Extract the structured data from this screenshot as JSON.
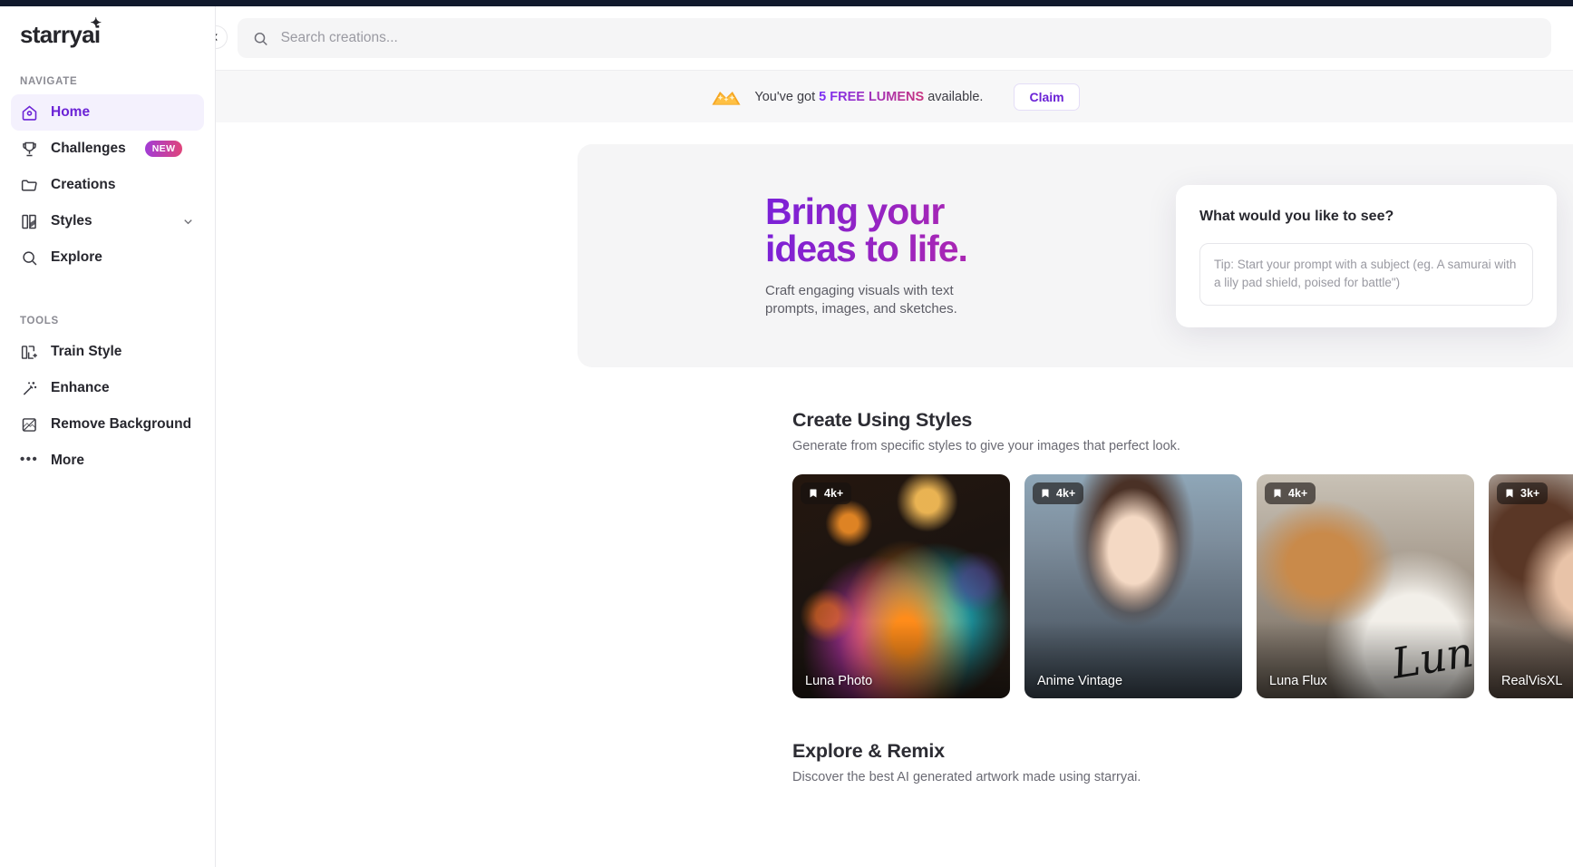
{
  "brand": {
    "name": "starryai"
  },
  "sidebar": {
    "groups": [
      {
        "label": "NAVIGATE",
        "items": [
          {
            "label": "Home",
            "icon": "home-icon",
            "active": true
          },
          {
            "label": "Challenges",
            "icon": "trophy-icon",
            "badge": "NEW"
          },
          {
            "label": "Creations",
            "icon": "folder-icon"
          },
          {
            "label": "Styles",
            "icon": "styles-icon",
            "chevron": "chevron-down-icon"
          },
          {
            "label": "Explore",
            "icon": "search-icon"
          }
        ]
      },
      {
        "label": "TOOLS",
        "items": [
          {
            "label": "Train Style",
            "icon": "train-style-icon"
          },
          {
            "label": "Enhance",
            "icon": "magic-wand-icon"
          },
          {
            "label": "Remove Background",
            "icon": "remove-background-icon"
          },
          {
            "label": "More",
            "icon": "ellipsis-icon"
          }
        ]
      }
    ]
  },
  "topbar": {
    "collapse_icon": "chevron-left-icon",
    "search": {
      "icon": "search-icon",
      "value": "",
      "placeholder": "Search creations..."
    }
  },
  "promo": {
    "icon": "lumens-icon",
    "prefix": "You've got ",
    "highlight": "5 FREE LUMENS",
    "suffix": " available.",
    "claim_label": "Claim",
    "accent": "#6b23d6"
  },
  "hero": {
    "title": "Bring your\nideas to life.",
    "subtitle": "Craft engaging visuals with text\nprompts, images, and sketches.",
    "gradient_from": "#7a21d8",
    "gradient_to": "#b62ba5",
    "prompt_card": {
      "title": "What would you like to see?",
      "placeholder": "Tip: Start your prompt with a subject (eg. A samurai with a lily pad shield, poised for battle\")"
    }
  },
  "sections": [
    {
      "title": "Create Using Styles",
      "subtitle": "Generate from specific styles to give your images that perfect look.",
      "cards": [
        {
          "label": "Luna Photo",
          "saves": "4k+",
          "art": "art-luna-photo"
        },
        {
          "label": "Anime Vintage",
          "saves": "4k+",
          "art": "art-anime"
        },
        {
          "label": "Luna Flux",
          "saves": "4k+",
          "art": "art-luna-flux",
          "overlay_text": "Luna"
        },
        {
          "label": "RealVisXL",
          "saves": "3k+",
          "art": "art-realvis"
        }
      ]
    },
    {
      "title": "Explore & Remix",
      "subtitle": "Discover the best AI generated artwork made using starryai.",
      "cards": []
    }
  ]
}
